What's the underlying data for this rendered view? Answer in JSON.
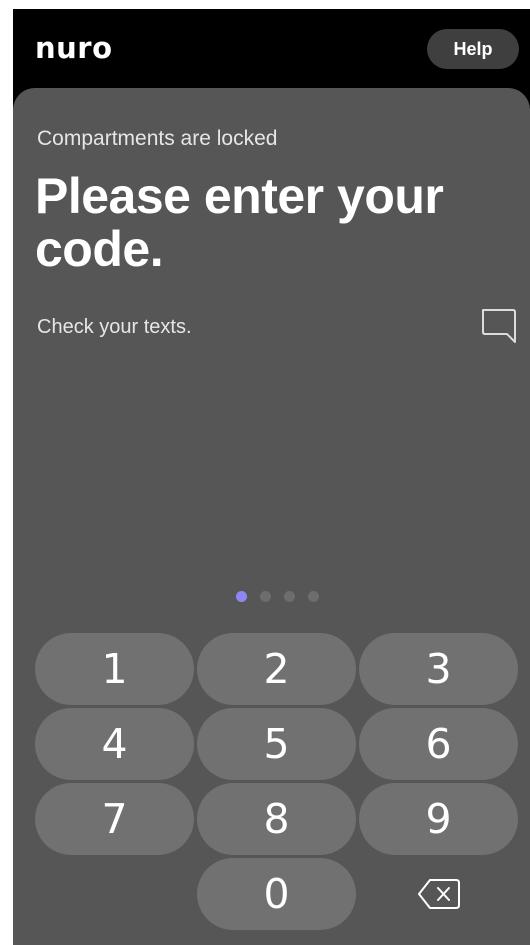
{
  "header": {
    "logo": "nuro",
    "help_label": "Help"
  },
  "main": {
    "status": "Compartments are locked",
    "title": "Please enter your code.",
    "hint": "Check your texts.",
    "hint_icon": "chat-bubble-icon"
  },
  "code_entry": {
    "length": 4,
    "active_index": 0,
    "active_color": "#8f86f5",
    "inactive_color": "#6d6d6d"
  },
  "keypad": {
    "keys": [
      "1",
      "2",
      "3",
      "4",
      "5",
      "6",
      "7",
      "8",
      "9",
      "0"
    ],
    "backspace_icon": "backspace-icon"
  },
  "colors": {
    "background": "#000000",
    "panel": "#565656",
    "key": "#717171",
    "help_button": "#3f3f3f"
  }
}
